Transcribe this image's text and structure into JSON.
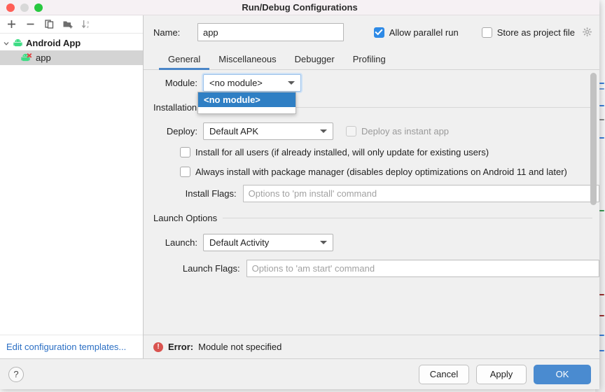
{
  "window": {
    "title": "Run/Debug Configurations",
    "traffic_lights": [
      "close-red",
      "minimize-gray",
      "zoom-green"
    ]
  },
  "sidebar": {
    "toolbar": [
      {
        "name": "add-icon",
        "label": "Add New Configuration"
      },
      {
        "name": "remove-icon",
        "label": "Remove Configuration"
      },
      {
        "name": "copy-icon",
        "label": "Copy Configuration"
      },
      {
        "name": "new-folder-icon",
        "label": "Create New Folder"
      },
      {
        "name": "sort-alphabetically-icon",
        "label": "Sort Configurations"
      }
    ],
    "tree": [
      {
        "label": "Android App",
        "icon": "android-icon",
        "expanded": true,
        "bold": true,
        "selected": false,
        "depth": 0
      },
      {
        "label": "app",
        "icon": "android-error-icon",
        "expanded": false,
        "bold": false,
        "selected": true,
        "depth": 1
      }
    ],
    "footer_link": "Edit configuration templates..."
  },
  "header": {
    "name_label": "Name:",
    "name_value": "app",
    "name_placeholder": "",
    "allow_parallel_run": {
      "label": "Allow parallel run",
      "checked": true
    },
    "store_as_project_file": {
      "label": "Store as project file",
      "checked": false
    },
    "gear_icon": "gear-icon"
  },
  "tabs": [
    {
      "label": "General",
      "active": true
    },
    {
      "label": "Miscellaneous",
      "active": false
    },
    {
      "label": "Debugger",
      "active": false
    },
    {
      "label": "Profiling",
      "active": false
    }
  ],
  "general": {
    "module": {
      "label": "Module:",
      "value": "<no module>",
      "open": true,
      "options": [
        "<no module>"
      ],
      "selected_option": "<no module>"
    },
    "installation_section": "Installation Options",
    "deploy": {
      "label": "Deploy:",
      "value": "Default APK",
      "options": [
        "Default APK"
      ]
    },
    "deploy_instant_app": {
      "label": "Deploy as instant app",
      "checked": false,
      "disabled": true
    },
    "install_all_users": {
      "label": "Install for all users (if already installed, will only update for existing users)",
      "checked": false
    },
    "always_package_manager": {
      "label": "Always install with package manager (disables deploy optimizations on Android 11 and later)",
      "checked": false
    },
    "install_flags": {
      "label": "Install Flags:",
      "value": "",
      "placeholder": "Options to 'pm install' command"
    },
    "launch_section": "Launch Options",
    "launch": {
      "label": "Launch:",
      "value": "Default Activity",
      "options": [
        "Default Activity"
      ]
    },
    "launch_flags": {
      "label": "Launch Flags:",
      "value": "",
      "placeholder": "Options to 'am start' command"
    }
  },
  "error": {
    "icon": "error-icon",
    "badge": "!",
    "label": "Error:",
    "message": "Module not specified"
  },
  "footer": {
    "help_label": "?",
    "cancel_label": "Cancel",
    "apply_label": "Apply",
    "ok_label": "OK"
  },
  "colors": {
    "accent": "#4a8bd0",
    "tab_underline": "#4a86c8",
    "checkbox_checked": "#2e8ae6",
    "selection_blue": "#2f7fc4",
    "error_red": "#d9534f",
    "link_blue": "#2b6fc4",
    "android_green": "#3ddc84"
  },
  "scrollbar": {
    "thumb_top_pct": 1,
    "thumb_height_pct": 48
  }
}
